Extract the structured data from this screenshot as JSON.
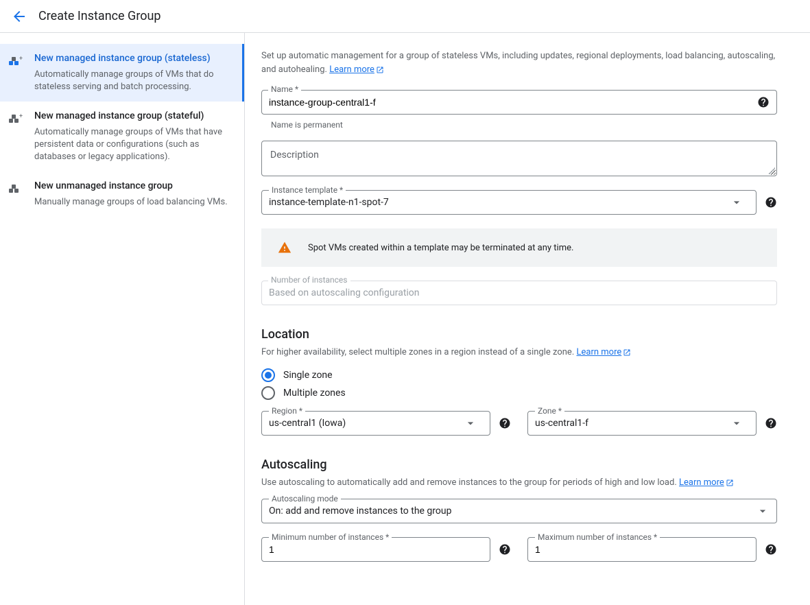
{
  "header": {
    "title": "Create Instance Group"
  },
  "sidebar": {
    "items": [
      {
        "title": "New managed instance group (stateless)",
        "desc": "Automatically manage groups of VMs that do stateless serving and batch processing."
      },
      {
        "title": "New managed instance group (stateful)",
        "desc": "Automatically manage groups of VMs that have persistent data or configurations (such as databases or legacy applications)."
      },
      {
        "title": "New unmanaged instance group",
        "desc": "Manually manage groups of load balancing VMs."
      }
    ]
  },
  "main": {
    "intro": "Set up automatic management for a group of stateless VMs, including updates, regional deployments, load balancing, autoscaling, and autohealing.",
    "learn_more": "Learn more",
    "name": {
      "label": "Name *",
      "value": "instance-group-central1-f",
      "hint": "Name is permanent"
    },
    "description": {
      "placeholder": "Description"
    },
    "instance_template": {
      "label": "Instance template *",
      "value": "instance-template-n1-spot-7"
    },
    "warning": "Spot VMs created within a template may be terminated at any time.",
    "num_instances": {
      "label": "Number of instances",
      "value": "Based on autoscaling configuration"
    },
    "location": {
      "title": "Location",
      "desc": "For higher availability, select multiple zones in a region instead of a single zone.",
      "single": "Single zone",
      "multiple": "Multiple zones",
      "region": {
        "label": "Region *",
        "value": "us-central1 (Iowa)"
      },
      "zone": {
        "label": "Zone *",
        "value": "us-central1-f"
      }
    },
    "autoscaling": {
      "title": "Autoscaling",
      "desc": "Use autoscaling to automatically add and remove instances to the group for periods of high and low load.",
      "mode": {
        "label": "Autoscaling mode",
        "value": "On: add and remove instances to the group"
      },
      "min": {
        "label": "Minimum number of instances *",
        "value": "1"
      },
      "max": {
        "label": "Maximum number of instances *",
        "value": "1"
      }
    }
  }
}
